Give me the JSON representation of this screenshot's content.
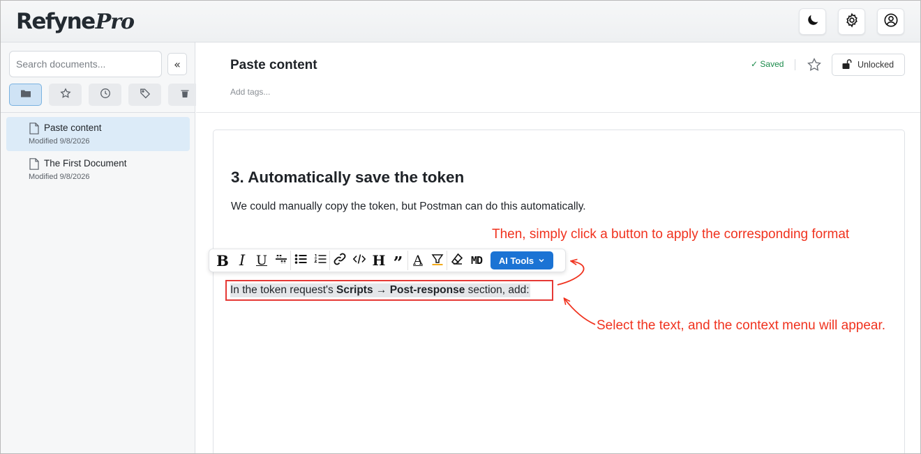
{
  "app": {
    "logo_main": "Refyne",
    "logo_sub": "Pro"
  },
  "header": {
    "buttons": [
      {
        "name": "theme-toggle",
        "icon": "moon-icon"
      },
      {
        "name": "settings",
        "icon": "gear-icon"
      },
      {
        "name": "account",
        "icon": "user-circle-icon"
      }
    ]
  },
  "sidebar": {
    "search_placeholder": "Search documents...",
    "collapse_label": "«",
    "filters": [
      {
        "icon": "folder-icon",
        "active": true
      },
      {
        "icon": "star-icon",
        "active": false
      },
      {
        "icon": "clock-icon",
        "active": false
      },
      {
        "icon": "tag-icon",
        "active": false
      },
      {
        "icon": "trash-icon",
        "active": false
      }
    ],
    "documents": [
      {
        "title": "Paste content",
        "modified": "Modified 9/8/2026",
        "active": true
      },
      {
        "title": "The First Document",
        "modified": "Modified 9/8/2026",
        "active": false
      }
    ]
  },
  "document": {
    "title": "Paste content",
    "tags_placeholder": "Add tags...",
    "saved_label": "✓ Saved",
    "lock_label": "Unlocked",
    "heading": "3. Automatically save the token",
    "paragraph": "We could manually copy the token, but Postman can do this automatically.",
    "selected": {
      "part1": "In the token request's ",
      "bold": "Scripts → Post-response",
      "part2": " section, add:"
    }
  },
  "toolbar": {
    "bold": "B",
    "italic": "I",
    "underline": "U",
    "heading": "H",
    "quote": "”",
    "text_color": "A",
    "markdown": "MD",
    "ai_tools_label": "AI Tools"
  },
  "annotations": {
    "top": "Then, simply click a button to apply the corresponding format",
    "bottom": "Select the text, and the context menu will appear.",
    "color": "#f0321e"
  },
  "colors": {
    "accent": "#1b73d4",
    "saved": "#1a8a4a",
    "active_item_bg": "#dcebf8"
  }
}
